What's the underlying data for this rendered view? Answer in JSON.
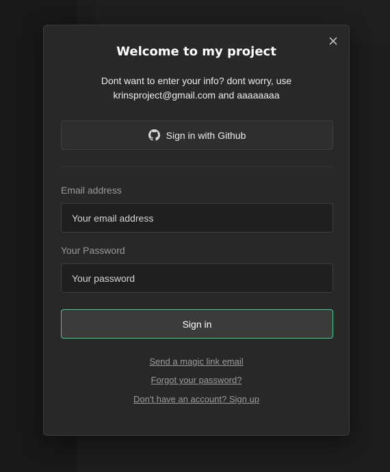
{
  "modal": {
    "title": "Welcome to my project",
    "subtitle_line1": "Dont want to enter your info? dont worry, use",
    "subtitle_line2": "krinsproject@gmail.com and aaaaaaaa",
    "close_icon": "close-icon"
  },
  "oauth": {
    "github_label": "Sign in with Github",
    "github_icon": "github-icon"
  },
  "form": {
    "email_label": "Email address",
    "email_placeholder": "Your email address",
    "email_value": "",
    "password_label": "Your Password",
    "password_placeholder": "Your password",
    "password_value": "",
    "submit_label": "Sign in"
  },
  "links": {
    "magic_link": "Send a magic link email",
    "forgot_password": "Forgot your password?",
    "sign_up": "Don't have an account? Sign up"
  },
  "colors": {
    "accent": "#3ecf8e",
    "modal_bg": "#282828",
    "page_bg": "#1c1c1c"
  }
}
